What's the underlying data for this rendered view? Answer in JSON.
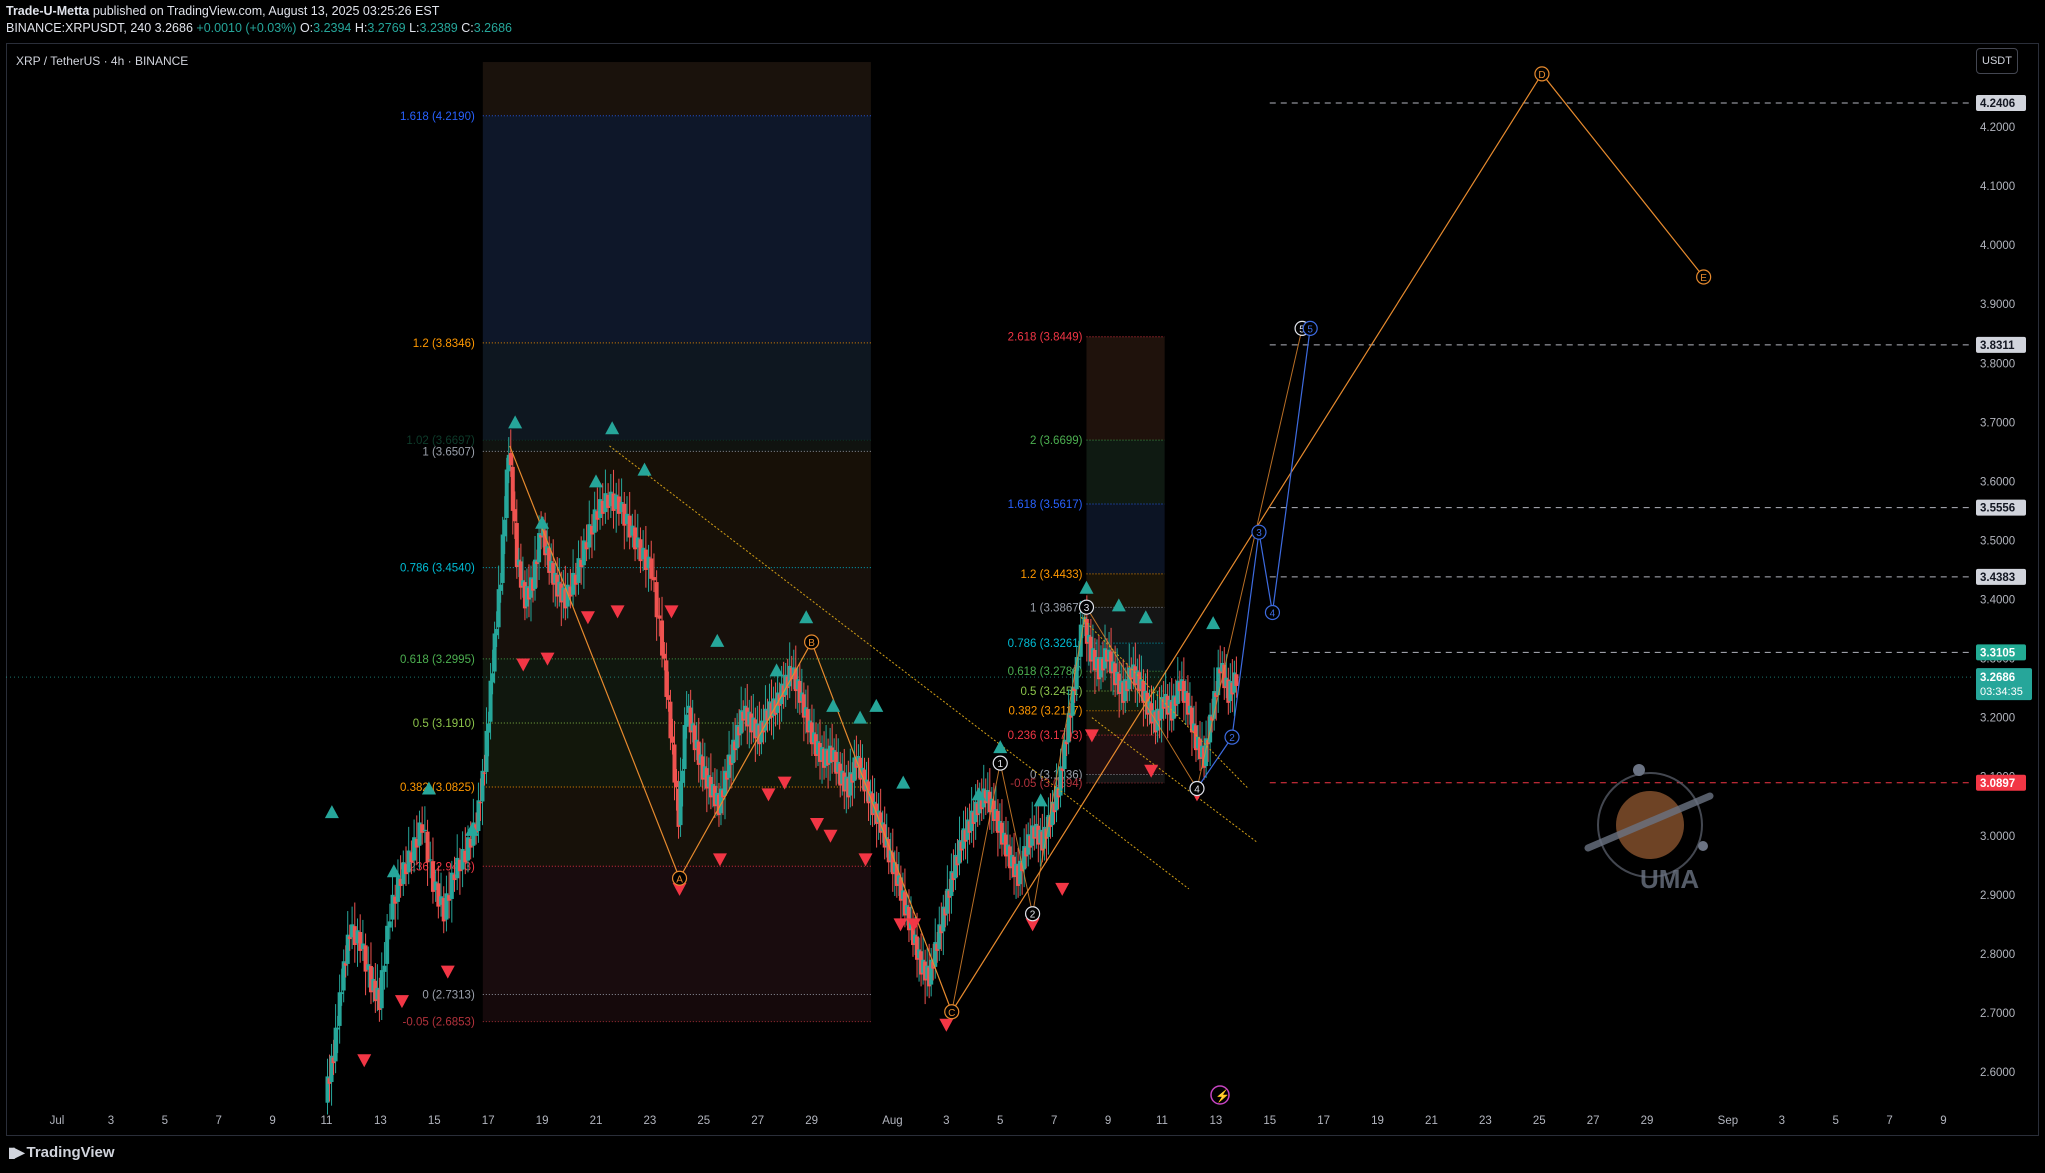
{
  "header": {
    "publisher": "Trade-U-Metta",
    "published_text": "published on TradingView.com, August 13, 2025 03:25:26 EST",
    "symbol_full": "BINANCE:XRPUSDT, 240",
    "price": "3.2686",
    "change": "+0.0010 (+0.03%)",
    "open_label": "O:",
    "open": "3.2394",
    "high_label": "H:",
    "high": "3.2769",
    "low_label": "L:",
    "low": "3.2389",
    "close_label": "C:",
    "close": "3.2686"
  },
  "chart_title": "XRP / TetherUS · 4h · BINANCE",
  "currency_button": "USDT",
  "footer_brand": "TradingView",
  "watermark_text": "UMA",
  "colors": {
    "up": "#26a69a",
    "down": "#ef5350",
    "triangle_up": "#26a69a",
    "triangle_down": "#f23645",
    "orange": "#e68a2e",
    "blue": "#3d6be0"
  },
  "chart_data": {
    "type": "candlestick",
    "symbol": "XRPUSDT",
    "timeframe": "4h",
    "ylim": [
      2.53,
      4.31
    ],
    "y_ticks": [
      "4.2000",
      "4.1000",
      "4.0000",
      "3.9000",
      "3.8000",
      "3.7000",
      "3.6000",
      "3.5000",
      "3.4000",
      "3.3000",
      "3.2000",
      "3.1000",
      "3.0000",
      "2.9000",
      "2.8000",
      "2.7000",
      "2.6000"
    ],
    "x_ticks": [
      {
        "day": 0,
        "label": "Jul"
      },
      {
        "day": 2,
        "label": "3"
      },
      {
        "day": 4,
        "label": "5"
      },
      {
        "day": 6,
        "label": "7"
      },
      {
        "day": 8,
        "label": "9"
      },
      {
        "day": 10,
        "label": "11"
      },
      {
        "day": 12,
        "label": "13"
      },
      {
        "day": 14,
        "label": "15"
      },
      {
        "day": 16,
        "label": "17"
      },
      {
        "day": 18,
        "label": "19"
      },
      {
        "day": 20,
        "label": "21"
      },
      {
        "day": 22,
        "label": "23"
      },
      {
        "day": 24,
        "label": "25"
      },
      {
        "day": 26,
        "label": "27"
      },
      {
        "day": 28,
        "label": "29"
      },
      {
        "day": 31,
        "label": "Aug"
      },
      {
        "day": 33,
        "label": "3"
      },
      {
        "day": 35,
        "label": "5"
      },
      {
        "day": 37,
        "label": "7"
      },
      {
        "day": 39,
        "label": "9"
      },
      {
        "day": 41,
        "label": "11"
      },
      {
        "day": 43,
        "label": "13"
      },
      {
        "day": 45,
        "label": "15"
      },
      {
        "day": 47,
        "label": "17"
      },
      {
        "day": 49,
        "label": "19"
      },
      {
        "day": 51,
        "label": "21"
      },
      {
        "day": 53,
        "label": "23"
      },
      {
        "day": 55,
        "label": "25"
      },
      {
        "day": 57,
        "label": "27"
      },
      {
        "day": 59,
        "label": "29"
      },
      {
        "day": 62,
        "label": "Sep"
      },
      {
        "day": 64,
        "label": "3"
      },
      {
        "day": 66,
        "label": "5"
      },
      {
        "day": 68,
        "label": "7"
      },
      {
        "day": 70,
        "label": "9"
      }
    ],
    "price_path": [
      [
        10.0,
        2.56
      ],
      [
        10.3,
        2.63
      ],
      [
        10.6,
        2.75
      ],
      [
        10.9,
        2.84
      ],
      [
        11.3,
        2.82
      ],
      [
        11.7,
        2.75
      ],
      [
        12.0,
        2.72
      ],
      [
        12.4,
        2.87
      ],
      [
        12.8,
        2.93
      ],
      [
        13.2,
        2.97
      ],
      [
        13.6,
        3.02
      ],
      [
        14.0,
        2.92
      ],
      [
        14.4,
        2.87
      ],
      [
        14.8,
        2.94
      ],
      [
        15.2,
        2.97
      ],
      [
        15.6,
        3.02
      ],
      [
        15.9,
        3.12
      ],
      [
        16.2,
        3.29
      ],
      [
        16.5,
        3.44
      ],
      [
        16.8,
        3.66
      ],
      [
        17.1,
        3.47
      ],
      [
        17.4,
        3.4
      ],
      [
        17.7,
        3.43
      ],
      [
        18.0,
        3.52
      ],
      [
        18.3,
        3.46
      ],
      [
        18.6,
        3.42
      ],
      [
        18.9,
        3.4
      ],
      [
        19.3,
        3.44
      ],
      [
        19.7,
        3.5
      ],
      [
        20.1,
        3.55
      ],
      [
        20.5,
        3.57
      ],
      [
        20.9,
        3.56
      ],
      [
        21.3,
        3.52
      ],
      [
        21.7,
        3.48
      ],
      [
        22.1,
        3.45
      ],
      [
        22.5,
        3.32
      ],
      [
        22.8,
        3.18
      ],
      [
        23.1,
        3.03
      ],
      [
        23.4,
        3.22
      ],
      [
        23.7,
        3.16
      ],
      [
        24.0,
        3.11
      ],
      [
        24.3,
        3.08
      ],
      [
        24.6,
        3.05
      ],
      [
        24.9,
        3.11
      ],
      [
        25.2,
        3.16
      ],
      [
        25.5,
        3.21
      ],
      [
        25.8,
        3.19
      ],
      [
        26.1,
        3.17
      ],
      [
        26.4,
        3.21
      ],
      [
        26.7,
        3.22
      ],
      [
        27.0,
        3.25
      ],
      [
        27.3,
        3.28
      ],
      [
        27.6,
        3.24
      ],
      [
        27.9,
        3.19
      ],
      [
        28.2,
        3.15
      ],
      [
        28.5,
        3.13
      ],
      [
        28.8,
        3.14
      ],
      [
        29.1,
        3.1
      ],
      [
        29.4,
        3.08
      ],
      [
        29.7,
        3.13
      ],
      [
        30.0,
        3.09
      ],
      [
        30.3,
        3.05
      ],
      [
        30.6,
        3.02
      ],
      [
        30.9,
        2.97
      ],
      [
        31.2,
        2.93
      ],
      [
        31.5,
        2.88
      ],
      [
        31.8,
        2.83
      ],
      [
        32.1,
        2.78
      ],
      [
        32.4,
        2.76
      ],
      [
        32.7,
        2.82
      ],
      [
        33.0,
        2.88
      ],
      [
        33.3,
        2.94
      ],
      [
        33.6,
        2.99
      ],
      [
        33.9,
        3.02
      ],
      [
        34.2,
        3.05
      ],
      [
        34.5,
        3.07
      ],
      [
        34.8,
        3.04
      ],
      [
        35.1,
        3.0
      ],
      [
        35.4,
        2.96
      ],
      [
        35.7,
        2.93
      ],
      [
        36.0,
        2.98
      ],
      [
        36.3,
        3.01
      ],
      [
        36.6,
        2.99
      ],
      [
        36.9,
        3.03
      ],
      [
        37.2,
        3.08
      ],
      [
        37.5,
        3.17
      ],
      [
        37.8,
        3.26
      ],
      [
        38.1,
        3.37
      ],
      [
        38.4,
        3.31
      ],
      [
        38.7,
        3.28
      ],
      [
        39.0,
        3.31
      ],
      [
        39.3,
        3.27
      ],
      [
        39.6,
        3.24
      ],
      [
        39.9,
        3.28
      ],
      [
        40.2,
        3.26
      ],
      [
        40.5,
        3.22
      ],
      [
        40.8,
        3.19
      ],
      [
        41.1,
        3.23
      ],
      [
        41.4,
        3.21
      ],
      [
        41.7,
        3.26
      ],
      [
        42.0,
        3.22
      ],
      [
        42.3,
        3.16
      ],
      [
        42.6,
        3.13
      ],
      [
        42.9,
        3.21
      ],
      [
        43.2,
        3.29
      ],
      [
        43.5,
        3.24
      ],
      [
        43.8,
        3.2686
      ]
    ],
    "wave_labels": [
      {
        "label": "A",
        "day": 23.1,
        "price": 2.928,
        "color": "orange"
      },
      {
        "label": "B",
        "day": 28.0,
        "price": 3.328,
        "color": "orange"
      },
      {
        "label": "C",
        "day": 33.2,
        "price": 2.702,
        "color": "orange"
      },
      {
        "label": "D",
        "day": 55.1,
        "price": 4.29,
        "color": "orange"
      },
      {
        "label": "E",
        "day": 61.1,
        "price": 3.946,
        "color": "orange"
      },
      {
        "label": "1",
        "day": 35.0,
        "price": 3.123,
        "color": "white"
      },
      {
        "label": "2",
        "day": 36.2,
        "price": 2.868,
        "color": "white"
      },
      {
        "label": "3",
        "day": 38.2,
        "price": 3.387,
        "color": "white"
      },
      {
        "label": "4",
        "day": 42.3,
        "price": 3.08,
        "color": "white"
      },
      {
        "label": "5",
        "day": 46.2,
        "price": 3.859,
        "color": "white"
      },
      {
        "label": "2",
        "day": 43.6,
        "price": 3.167,
        "color": "blue"
      },
      {
        "label": "3",
        "day": 44.6,
        "price": 3.514,
        "color": "blue"
      },
      {
        "label": "4",
        "day": 45.1,
        "price": 3.378,
        "color": "blue"
      },
      {
        "label": "5",
        "day": 46.5,
        "price": 3.859,
        "color": "blue"
      }
    ],
    "fib_left": [
      {
        "label": "1.618 (4.2190)",
        "price": 4.219,
        "color": "#2962ff"
      },
      {
        "label": "1.2 (3.8346)",
        "price": 3.8346,
        "color": "#ff9800"
      },
      {
        "label": "1.02 (3.6697)",
        "price": 3.6697,
        "color": "#0d3b2a"
      },
      {
        "label": "1 (3.6507)",
        "price": 3.6507,
        "color": "#9aa0ab"
      },
      {
        "label": "0.786 (3.4540)",
        "price": 3.454,
        "color": "#00bcd4"
      },
      {
        "label": "0.618 (3.2995)",
        "price": 3.2995,
        "color": "#4caf50"
      },
      {
        "label": "0.5 (3.1910)",
        "price": 3.191,
        "color": "#8bc34a"
      },
      {
        "label": "0.382 (3.0825)",
        "price": 3.0825,
        "color": "#ff9800"
      },
      {
        "label": "0.236 (2.9483)",
        "price": 2.9483,
        "color": "#f23645"
      },
      {
        "label": "0 (2.7313)",
        "price": 2.7313,
        "color": "#9aa0ab"
      },
      {
        "label": "-0.05 (2.6853)",
        "price": 2.6853,
        "color": "#b2323c"
      }
    ],
    "fib_right": [
      {
        "label": "2.618 (3.8449)",
        "price": 3.8449,
        "color": "#f23645"
      },
      {
        "label": "2 (3.6699)",
        "price": 3.6699,
        "color": "#4caf50"
      },
      {
        "label": "1.618 (3.5617)",
        "price": 3.5617,
        "color": "#2962ff"
      },
      {
        "label": "1.2 (3.4433)",
        "price": 3.4433,
        "color": "#ff9800"
      },
      {
        "label": "1 (3.3867)",
        "price": 3.3867,
        "color": "#9aa0ab"
      },
      {
        "label": "0.786 (3.3261)",
        "price": 3.3261,
        "color": "#00bcd4"
      },
      {
        "label": "0.618 (3.2786)",
        "price": 3.2786,
        "color": "#4caf50"
      },
      {
        "label": "0.5 (3.2451)",
        "price": 3.2451,
        "color": "#8bc34a"
      },
      {
        "label": "0.382 (3.2117)",
        "price": 3.2117,
        "color": "#ff9800"
      },
      {
        "label": "0.236 (3.1703)",
        "price": 3.1703,
        "color": "#f23645"
      },
      {
        "label": "0 (3.1036)",
        "price": 3.1036,
        "color": "#9aa0ab"
      },
      {
        "label": "-0.05 (3.0894)",
        "price": 3.0894,
        "color": "#b2323c"
      }
    ],
    "price_tags": [
      {
        "label": "4.2406",
        "price": 4.2406,
        "bg": "#d1d4dc",
        "fg": "#131722",
        "line": "white-dashed"
      },
      {
        "label": "3.8311",
        "price": 3.8311,
        "bg": "#d1d4dc",
        "fg": "#131722",
        "line": "white-dashed"
      },
      {
        "label": "3.5556",
        "price": 3.5556,
        "bg": "#d1d4dc",
        "fg": "#131722",
        "line": "white-dashed"
      },
      {
        "label": "3.4383",
        "price": 3.4383,
        "bg": "#d1d4dc",
        "fg": "#131722",
        "line": "white-dashed"
      },
      {
        "label": "3.3105",
        "price": 3.3105,
        "bg": "#22ab94",
        "fg": "#ffffff",
        "line": "white-dashed"
      },
      {
        "label": "3.0897",
        "price": 3.0897,
        "bg": "#f23645",
        "fg": "#ffffff",
        "line": "red-dashed"
      }
    ],
    "current_price": {
      "price": 3.2686,
      "label": "3.2686",
      "countdown": "03:34:35",
      "bg": "#26a69a"
    },
    "triangles_up": [
      [
        10.2,
        3.04
      ],
      [
        12.5,
        2.94
      ],
      [
        13.8,
        3.08
      ],
      [
        15.4,
        3.01
      ],
      [
        17.0,
        3.7
      ],
      [
        18.0,
        3.53
      ],
      [
        20.0,
        3.6
      ],
      [
        20.6,
        3.69
      ],
      [
        21.8,
        3.62
      ],
      [
        24.5,
        3.33
      ],
      [
        26.7,
        3.28
      ],
      [
        27.8,
        3.37
      ],
      [
        28.8,
        3.22
      ],
      [
        29.8,
        3.2
      ],
      [
        30.4,
        3.22
      ],
      [
        31.4,
        3.09
      ],
      [
        34.2,
        3.07
      ],
      [
        35.0,
        3.15
      ],
      [
        36.5,
        3.06
      ],
      [
        38.2,
        3.42
      ],
      [
        39.4,
        3.39
      ],
      [
        40.4,
        3.37
      ],
      [
        42.9,
        3.36
      ]
    ],
    "triangles_down": [
      [
        11.4,
        2.62
      ],
      [
        12.8,
        2.72
      ],
      [
        14.5,
        2.77
      ],
      [
        17.3,
        3.29
      ],
      [
        18.2,
        3.3
      ],
      [
        19.7,
        3.37
      ],
      [
        20.8,
        3.38
      ],
      [
        22.8,
        3.38
      ],
      [
        23.1,
        2.91
      ],
      [
        24.6,
        2.96
      ],
      [
        26.4,
        3.07
      ],
      [
        27.0,
        3.09
      ],
      [
        28.2,
        3.02
      ],
      [
        28.7,
        3.0
      ],
      [
        30.0,
        2.96
      ],
      [
        31.3,
        2.85
      ],
      [
        31.8,
        2.85
      ],
      [
        33.0,
        2.68
      ],
      [
        36.2,
        2.85
      ],
      [
        37.3,
        2.91
      ],
      [
        38.4,
        3.17
      ],
      [
        40.6,
        3.11
      ],
      [
        42.3,
        3.07
      ]
    ],
    "annotations": [
      "Elliott wave ABCDE (orange)",
      "Impulse 1-5 (white/blue)",
      "Fibonacci retracement zones"
    ]
  }
}
